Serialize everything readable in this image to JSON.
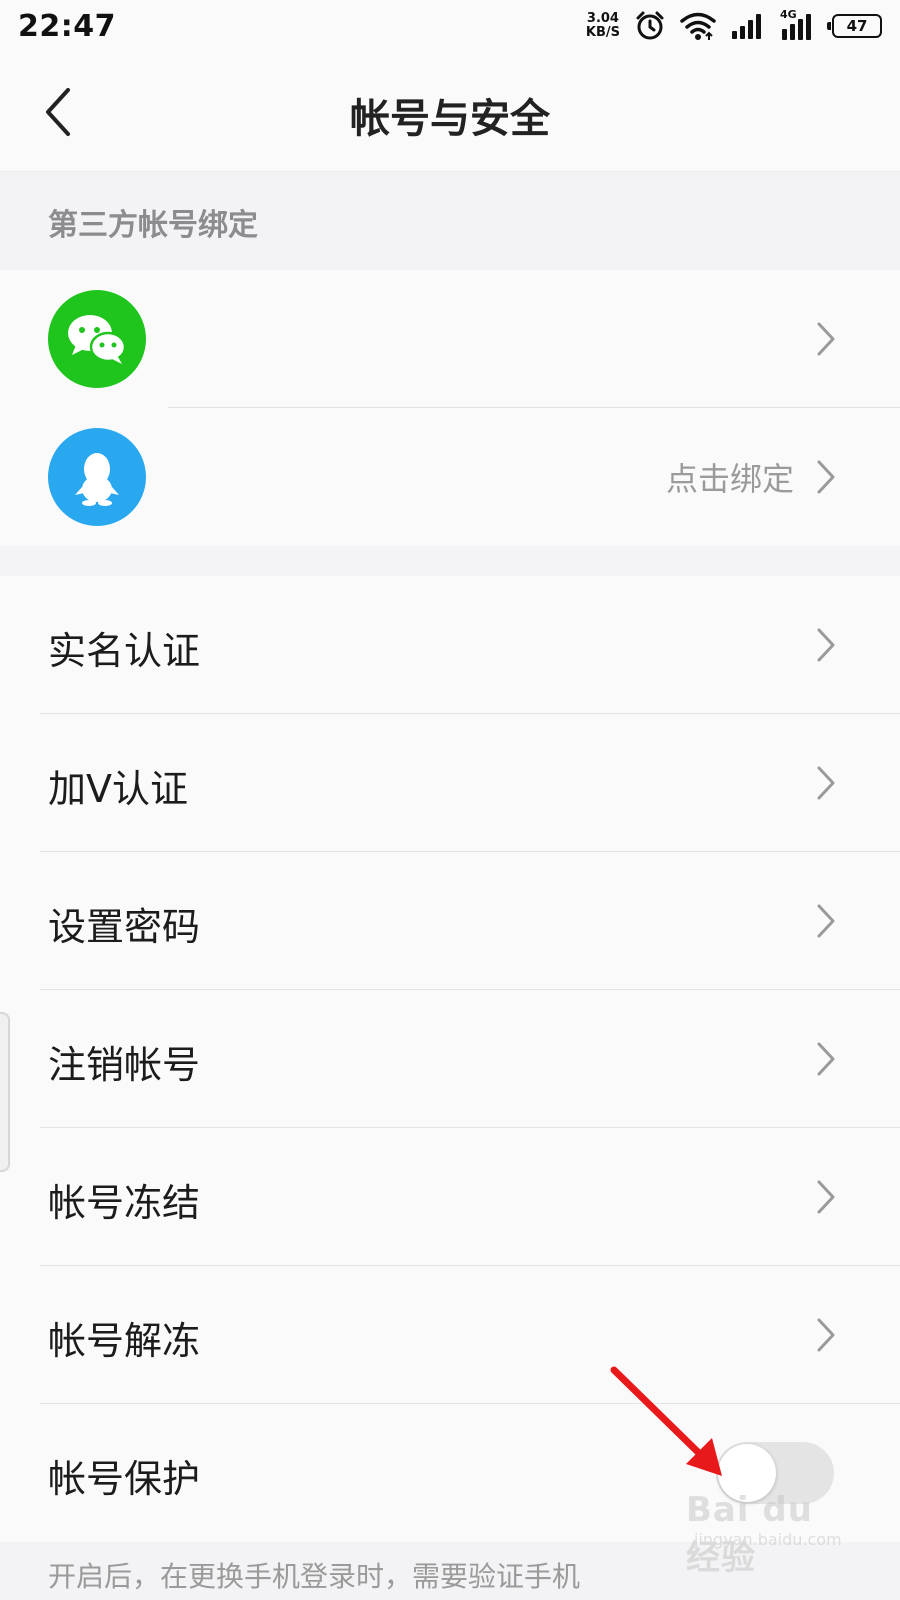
{
  "status_bar": {
    "time": "22:47",
    "net_speed_value": "3.04",
    "net_speed_unit": "KB/S",
    "network_label": "4G",
    "battery": "47",
    "icons": [
      "alarm-icon",
      "wifi-icon",
      "signal-icon",
      "signal-4g-icon",
      "battery-icon"
    ]
  },
  "nav": {
    "title": "帐号与安全",
    "back_icon": "chevron-left-icon"
  },
  "third_party": {
    "header": "第三方帐号绑定",
    "items": [
      {
        "icon": "wechat-icon",
        "color": "#1fc41c",
        "status": ""
      },
      {
        "icon": "qq-icon",
        "color": "#2aa8ef",
        "status": "点击绑定"
      }
    ]
  },
  "settings": {
    "items": [
      {
        "label": "实名认证"
      },
      {
        "label": "加V认证"
      },
      {
        "label": "设置密码"
      },
      {
        "label": "注销帐号"
      },
      {
        "label": "帐号冻结"
      },
      {
        "label": "帐号解冻"
      },
      {
        "label": "帐号保护",
        "toggle_on": false
      }
    ]
  },
  "bottom_note": "开启后，在更换手机登录时，需要验证手机",
  "watermark": {
    "text": "Bai du 经验",
    "url": "jingyan.baidu.com"
  },
  "annotation_color": "#e8191a"
}
